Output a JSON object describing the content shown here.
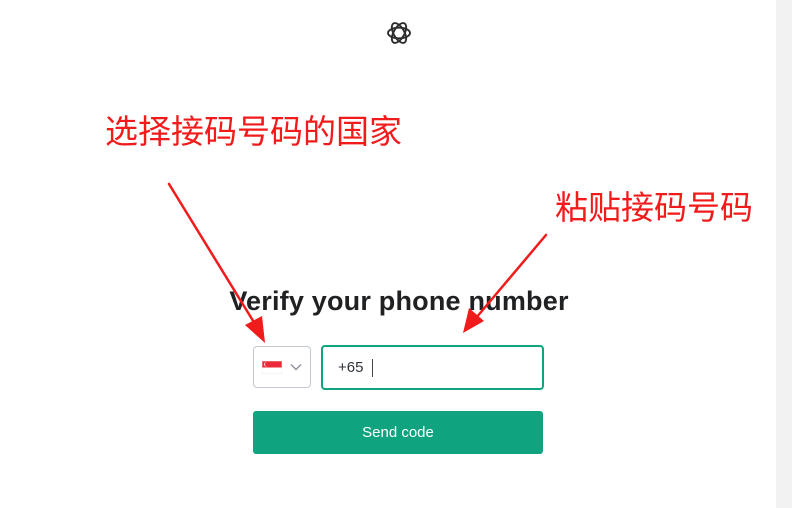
{
  "header": {
    "logo_icon": "openai-logo-icon"
  },
  "form": {
    "title": "Verify your phone number",
    "country": {
      "flag_icon": "singapore-flag-icon",
      "dropdown_icon": "chevron-down-icon"
    },
    "phone": {
      "value": "+65"
    },
    "send_button_label": "Send code"
  },
  "annotations": {
    "select_country": "选择接码号码的国家",
    "paste_number": "粘贴接码号码",
    "color": "#f21b1b"
  },
  "colors": {
    "accent": "#10a37f",
    "title": "#202123",
    "annotation": "#f21b1b"
  }
}
